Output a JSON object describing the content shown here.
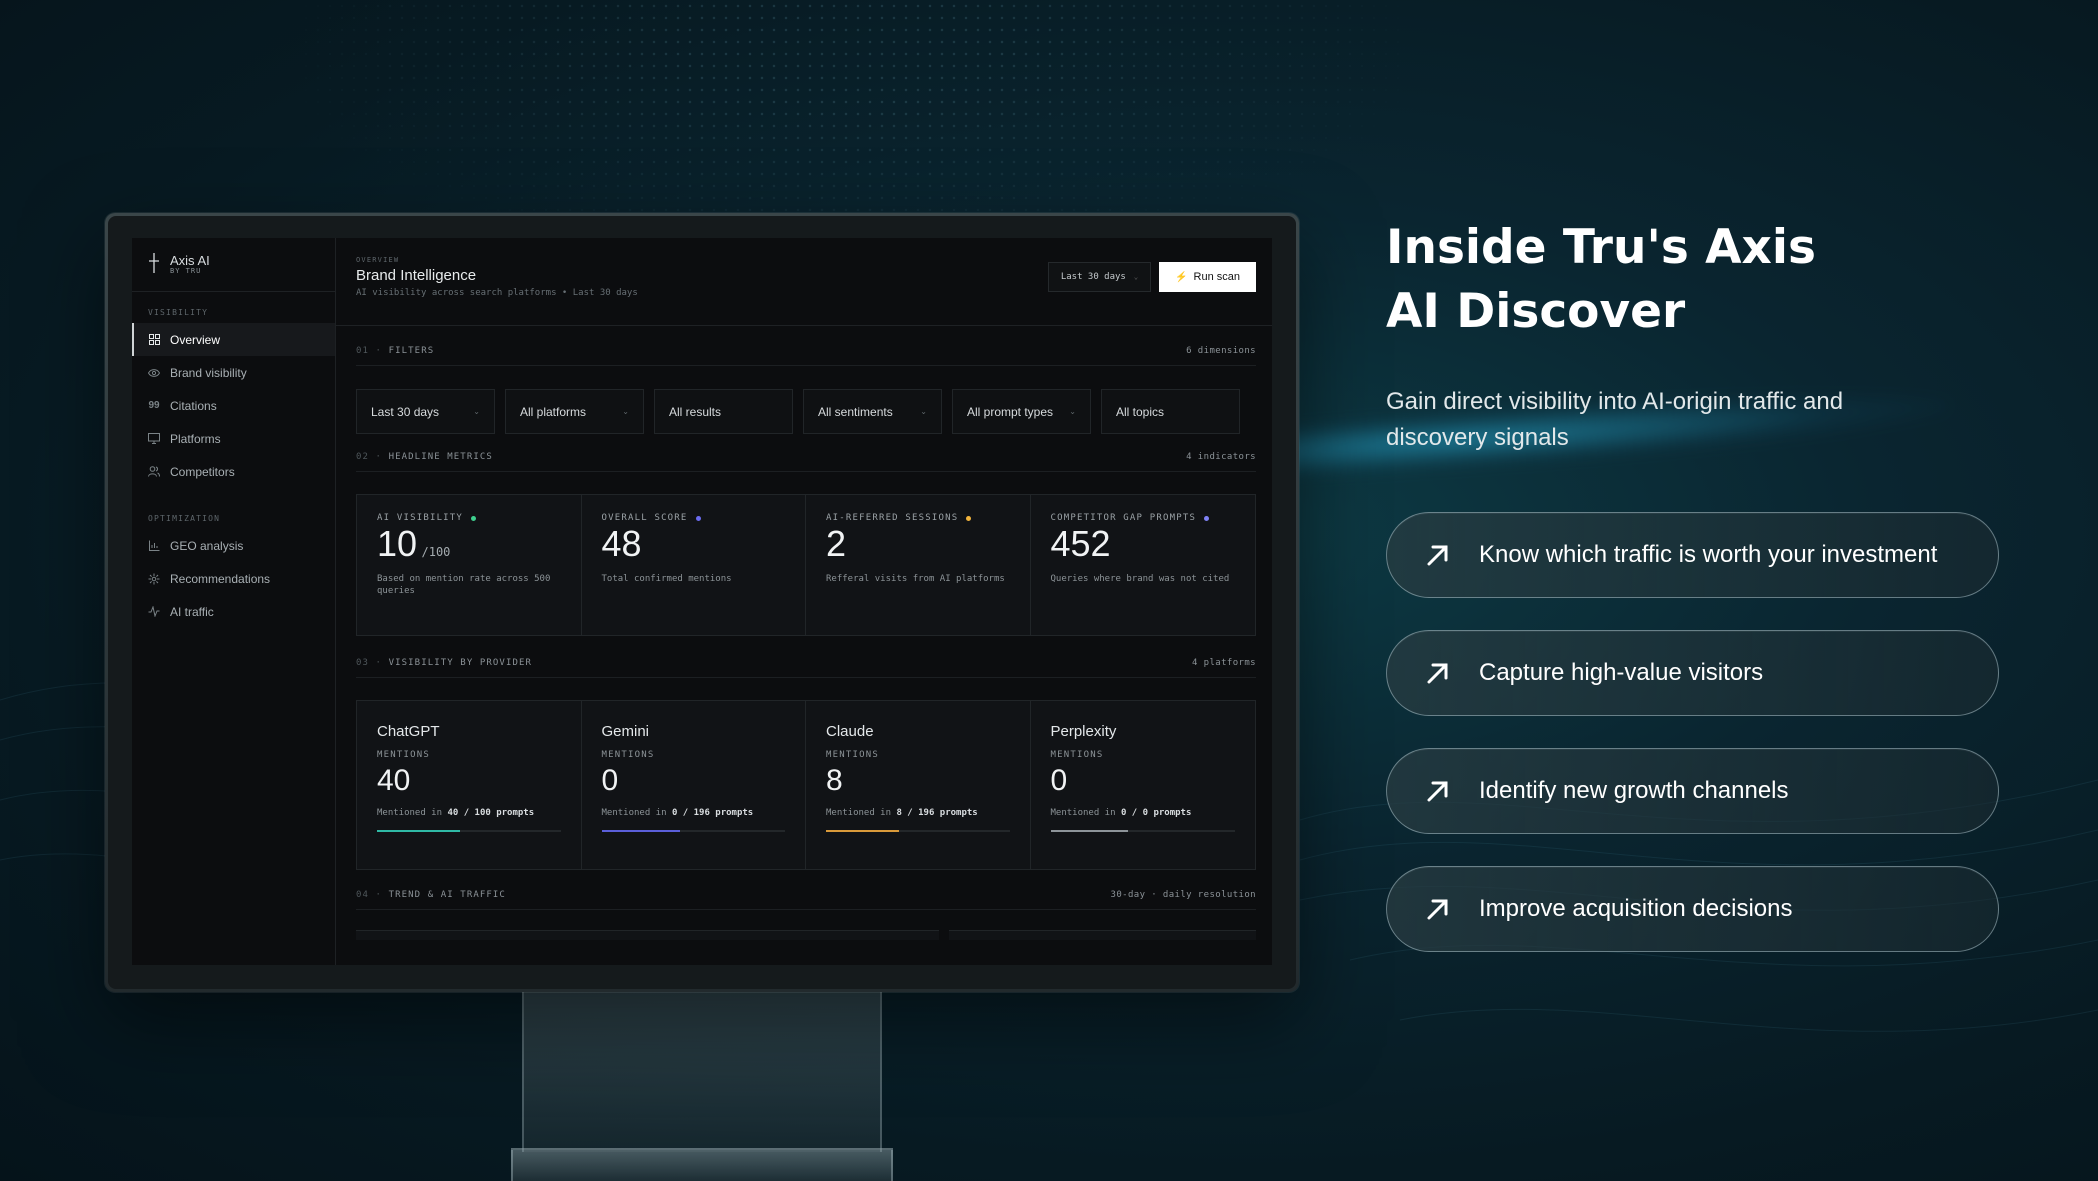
{
  "hero": {
    "title_line1": "Inside Tru's Axis",
    "title_line2": "AI Discover",
    "subtitle": "Gain direct visibility into AI-origin traffic and discovery signals",
    "benefits": [
      "Know which traffic is worth your investment",
      "Capture high-value visitors",
      "Identify new growth channels",
      "Improve acquisition decisions"
    ]
  },
  "app": {
    "brand": {
      "name": "Axis AI",
      "sub": "BY TRU"
    },
    "sidebar": {
      "section_visibility": "VISIBILITY",
      "section_optimization": "OPTIMIZATION",
      "items": [
        {
          "label": "Overview",
          "icon": "grid-icon"
        },
        {
          "label": "Brand visibility",
          "icon": "eye-icon"
        },
        {
          "label": "Citations",
          "icon": "quote-icon"
        },
        {
          "label": "Platforms",
          "icon": "monitor-icon"
        },
        {
          "label": "Competitors",
          "icon": "users-icon"
        },
        {
          "label": "GEO analysis",
          "icon": "bar-chart-icon"
        },
        {
          "label": "Recommendations",
          "icon": "sparkle-icon"
        },
        {
          "label": "AI traffic",
          "icon": "pulse-icon"
        }
      ]
    },
    "header": {
      "eyebrow": "OVERVIEW",
      "title": "Brand Intelligence",
      "subtitle": "AI visibility across search platforms • Last 30 days",
      "range": "Last 30 days",
      "run_scan": "Run scan"
    },
    "sections": {
      "filters": {
        "num": "01 ·",
        "label": "FILTERS",
        "right": "6 dimensions"
      },
      "metrics": {
        "num": "02 ·",
        "label": "HEADLINE METRICS",
        "right": "4 indicators"
      },
      "providers": {
        "num": "03 ·",
        "label": "VISIBILITY BY PROVIDER",
        "right": "4 platforms"
      },
      "trend": {
        "num": "04 ·",
        "label": "TREND & AI TRAFFIC",
        "right": "30-day · daily resolution"
      }
    },
    "filters": [
      "Last 30 days",
      "All platforms",
      "All results",
      "All sentiments",
      "All prompt types",
      "All topics"
    ],
    "metrics": [
      {
        "label": "AI VISIBILITY",
        "value": "10",
        "unit": "/100",
        "desc": "Based on mention rate across 500 queries",
        "dot_color": "#3ecf8e"
      },
      {
        "label": "OVERALL SCORE",
        "value": "48",
        "unit": "",
        "desc": "Total confirmed mentions",
        "dot_color": "#6b6cf0"
      },
      {
        "label": "AI-REFERRED SESSIONS",
        "value": "2",
        "unit": "",
        "desc": "Refferal visits from AI platforms",
        "dot_color": "#f2b43c"
      },
      {
        "label": "COMPETITOR GAP PROMPTS",
        "value": "452",
        "unit": "",
        "desc": "Queries where brand was not cited",
        "dot_color": "#7f82f5"
      }
    ],
    "providers": [
      {
        "name": "ChatGPT",
        "label": "MENTIONS",
        "value": "40",
        "desc_pre": "Mentioned in",
        "desc_bold": "40 / 100 prompts",
        "bar_color": "#2fb9a5",
        "bar_pct": 45
      },
      {
        "name": "Gemini",
        "label": "MENTIONS",
        "value": "0",
        "desc_pre": "Mentioned in",
        "desc_bold": "0 / 196 prompts",
        "bar_color": "#5b5fd9",
        "bar_pct": 43
      },
      {
        "name": "Claude",
        "label": "MENTIONS",
        "value": "8",
        "desc_pre": "Mentioned in",
        "desc_bold": "8 / 196 prompts",
        "bar_color": "#d99a3a",
        "bar_pct": 40
      },
      {
        "name": "Perplexity",
        "label": "MENTIONS",
        "value": "0",
        "desc_pre": "Mentioned in",
        "desc_bold": "0 / 0 prompts",
        "bar_color": "#8d9499",
        "bar_pct": 42
      }
    ]
  }
}
